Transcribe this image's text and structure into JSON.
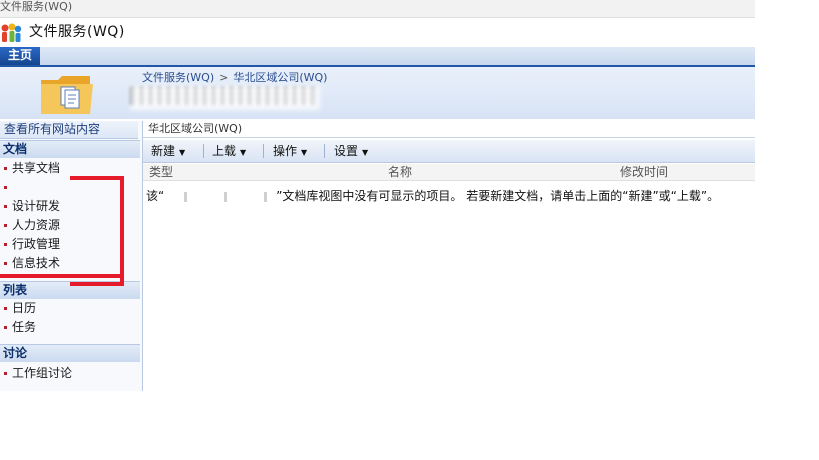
{
  "window": {
    "title_tab": "文件服务(WQ)"
  },
  "site": {
    "title": "文件服务(WQ)"
  },
  "tabs": {
    "home": "主页"
  },
  "breadcrumb": {
    "root": "文件服务(WQ)",
    "separator": ">",
    "current": "华北区域公司(WQ)"
  },
  "nav": {
    "view_all": "查看所有网站内容",
    "documents": {
      "header": "文档",
      "items": [
        "共享文档",
        "",
        "设计研发",
        "人力资源",
        "行政管理",
        "信息技术"
      ]
    },
    "lists": {
      "header": "列表",
      "items": [
        "日历",
        "任务"
      ]
    },
    "discussions": {
      "header": "讨论",
      "items": [
        "工作组讨论"
      ]
    }
  },
  "content": {
    "library_title": "华北区域公司(WQ)",
    "toolbar": {
      "new": "新建",
      "upload": "上载",
      "actions": "操作",
      "settings": "设置"
    },
    "columns": {
      "type": "类型",
      "name": "名称",
      "modified": "修改时间"
    },
    "empty_prefix": "该“",
    "empty_suffix": "”文档库视图中没有可显示的项目。 若要新建文档，请单击上面的“新建”或“上载”。"
  },
  "colors": {
    "tab_blue": "#1f57a8",
    "annotation_red": "#e51a2b",
    "bullet": "#b5202c"
  }
}
